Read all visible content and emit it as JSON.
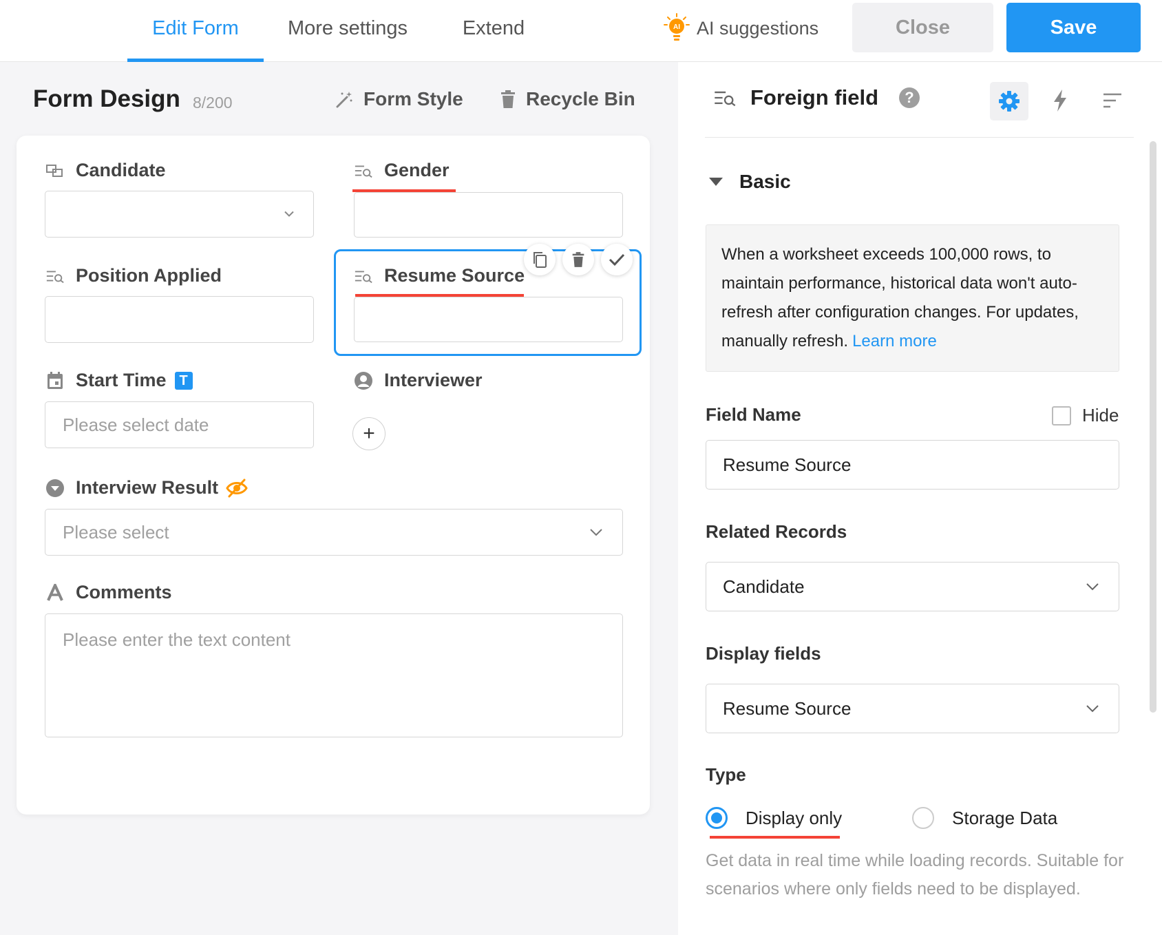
{
  "tabs": [
    {
      "label": "Edit Form",
      "active": true
    },
    {
      "label": "More settings",
      "active": false
    },
    {
      "label": "Extend",
      "active": false
    }
  ],
  "header": {
    "ai_suggestions": "AI suggestions",
    "ai_badge": "AI",
    "close": "Close",
    "save": "Save"
  },
  "form_design": {
    "title": "Form Design",
    "count": "8/200",
    "form_style": "Form Style",
    "recycle_bin": "Recycle Bin"
  },
  "fields": {
    "candidate": {
      "label": "Candidate",
      "value": ""
    },
    "gender": {
      "label": "Gender",
      "value": ""
    },
    "position_applied": {
      "label": "Position Applied",
      "value": ""
    },
    "resume_source": {
      "label": "Resume Source",
      "value": ""
    },
    "start_time": {
      "label": "Start Time",
      "badge": "T",
      "placeholder": "Please select date"
    },
    "interviewer": {
      "label": "Interviewer",
      "add": "+"
    },
    "interview_result": {
      "label": "Interview Result",
      "placeholder": "Please select"
    },
    "comments": {
      "label": "Comments",
      "placeholder": "Please enter the text content"
    }
  },
  "panel": {
    "title": "Foreign field",
    "help": "?",
    "section": "Basic",
    "notice": "When a worksheet exceeds 100,000 rows, to maintain performance, historical data won't auto-refresh after configuration changes. For updates, manually refresh.",
    "learn_more": "Learn more",
    "field_name_label": "Field Name",
    "hide_label": "Hide",
    "hide_checked": false,
    "field_name_value": "Resume Source",
    "related_records_label": "Related Records",
    "related_records_value": "Candidate",
    "display_fields_label": "Display fields",
    "display_fields_value": "Resume Source",
    "type_label": "Type",
    "type_options": [
      {
        "label": "Display only",
        "selected": true
      },
      {
        "label": "Storage Data",
        "selected": false
      }
    ],
    "type_description": "Get data in real time while loading records. Suitable for scenarios where only fields need to be displayed."
  },
  "colors": {
    "accent": "#2196f3",
    "error_underline": "#f44336",
    "hidden_icon": "#ff9800"
  }
}
